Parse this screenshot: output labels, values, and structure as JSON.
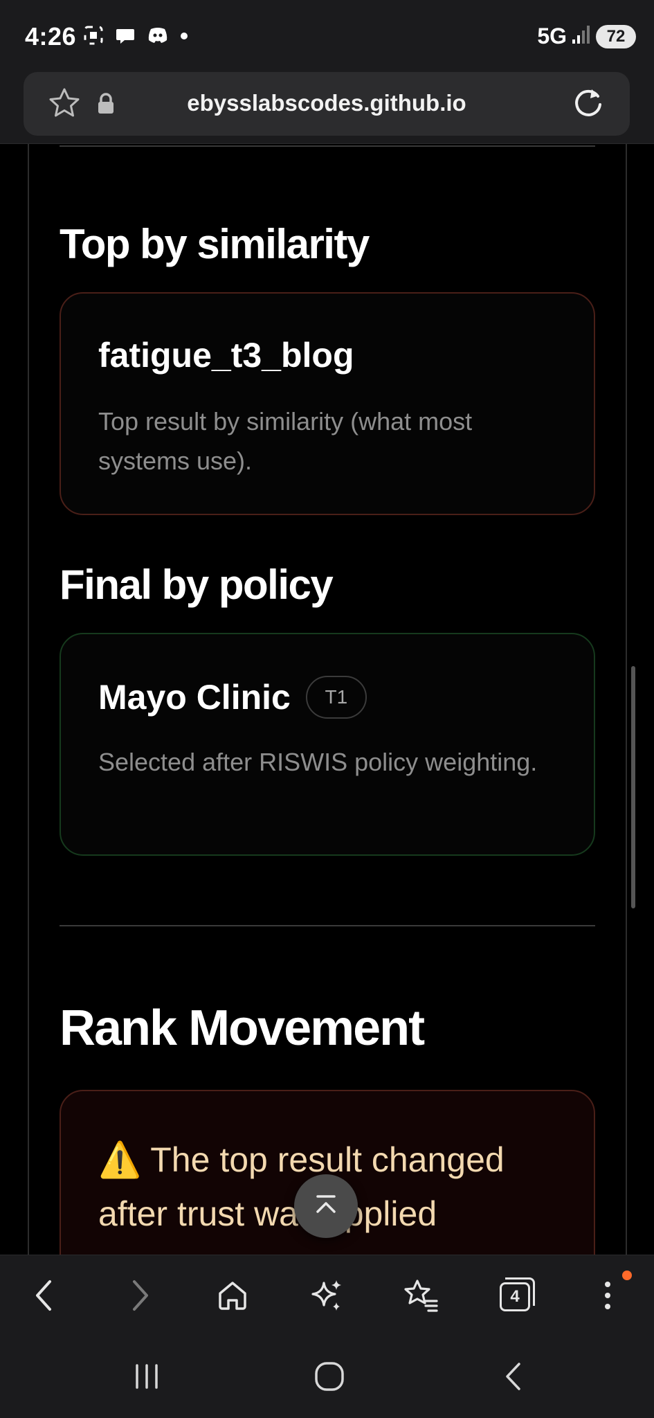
{
  "status_bar": {
    "time": "4:26",
    "network": "5G",
    "battery": "72"
  },
  "browser": {
    "url": "ebysslabscodes.github.io"
  },
  "sections": {
    "top_similarity": {
      "heading": "Top by similarity",
      "card_title": "fatigue_t3_blog",
      "card_description": "Top result by similarity (what most systems use)."
    },
    "final_policy": {
      "heading": "Final by policy",
      "card_title": "Mayo Clinic",
      "badge": "T1",
      "card_description": "Selected after RISWIS policy weighting."
    },
    "rank_movement": {
      "heading": "Rank Movement",
      "alert_icon": "⚠️",
      "alert_text": "The top result changed after trust was applied"
    }
  },
  "toolbar": {
    "tab_count": "4"
  },
  "icons": {
    "back": "chevron-left-icon",
    "forward": "chevron-right-icon",
    "home": "home-icon",
    "ai": "sparkles-icon",
    "bookmarks": "star-list-icon",
    "tabs": "tabs-icon",
    "menu": "more-vertical-icon",
    "scroll_top": "chevron-up-icon"
  },
  "colors": {
    "card_red_border": "#4a1f18",
    "card_green_border": "#163a1d",
    "alert_text": "#f3d9b0",
    "notification_dot": "#ff6a2a"
  }
}
